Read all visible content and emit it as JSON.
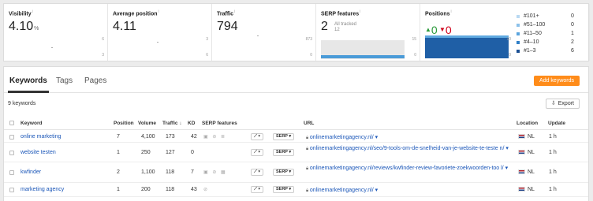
{
  "metrics": {
    "visibility": {
      "title": "Visibility",
      "value": "4.10",
      "unit": "%",
      "axis_top": "6",
      "axis_bottom": "3"
    },
    "avg_position": {
      "title": "Average position",
      "value": "4.11",
      "axis_top": "3",
      "axis_bottom": "6"
    },
    "traffic": {
      "title": "Traffic",
      "value": "794",
      "axis_top": "873",
      "axis_bottom": "0"
    },
    "serp_features": {
      "title": "SERP features",
      "value": "2",
      "sub_label": "All tracked",
      "sub_value": "12",
      "axis_top": "15",
      "axis_bottom": "0"
    },
    "positions": {
      "title": "Positions",
      "up_value": "0",
      "down_value": "0",
      "axis_top": "10",
      "axis_bottom": "0"
    },
    "info_mark": "i"
  },
  "legend": [
    {
      "label": "#101+",
      "value": "0",
      "color": "#b9d9f2"
    },
    {
      "label": "#51–100",
      "value": "0",
      "color": "#8cc1ea"
    },
    {
      "label": "#11–50",
      "value": "1",
      "color": "#5aa4de"
    },
    {
      "label": "#4–10",
      "value": "2",
      "color": "#2f7fc7"
    },
    {
      "label": "#1–3",
      "value": "6",
      "color": "#1b4f93"
    }
  ],
  "tabs": [
    "Keywords",
    "Tags",
    "Pages"
  ],
  "add_keywords_label": "Add keywords",
  "keyword_count": "9 keywords",
  "export_label": "Export",
  "table": {
    "headers": {
      "keyword": "Keyword",
      "position": "Position",
      "volume": "Volume",
      "traffic": "Traffic",
      "kd": "KD",
      "serp_features": "SERP features",
      "url": "URL",
      "location": "Location",
      "update": "Update"
    },
    "serp_button": "SERP",
    "rows": [
      {
        "keyword": "online marketing",
        "position": "7",
        "volume": "4,100",
        "traffic": "173",
        "kd": "42",
        "features": "▣ ⊘ ≣",
        "url": "onlinemarketingagency.nl/",
        "location": "NL",
        "update": "1 h"
      },
      {
        "keyword": "website testen",
        "position": "1",
        "volume": "250",
        "traffic": "127",
        "kd": "0",
        "features": "",
        "url": "onlinemarketingagency.nl/seo/9-tools-om-de-snelheid-van-je-website-te-teste n/",
        "location": "NL",
        "update": "1 h"
      },
      {
        "keyword": "kwfinder",
        "position": "2",
        "volume": "1,100",
        "traffic": "118",
        "kd": "7",
        "features": "▣ ⊘ ▦",
        "url": "onlinemarketingagency.nl/reviews/kwfinder-review-favoriete-zoekwoorden-too l/",
        "location": "NL",
        "update": "1 h"
      },
      {
        "keyword": "marketing agency",
        "position": "1",
        "volume": "200",
        "traffic": "118",
        "kd": "43",
        "features": "⊘",
        "url": "onlinemarketingagency.nl/",
        "location": "NL",
        "update": "1 h"
      }
    ]
  }
}
